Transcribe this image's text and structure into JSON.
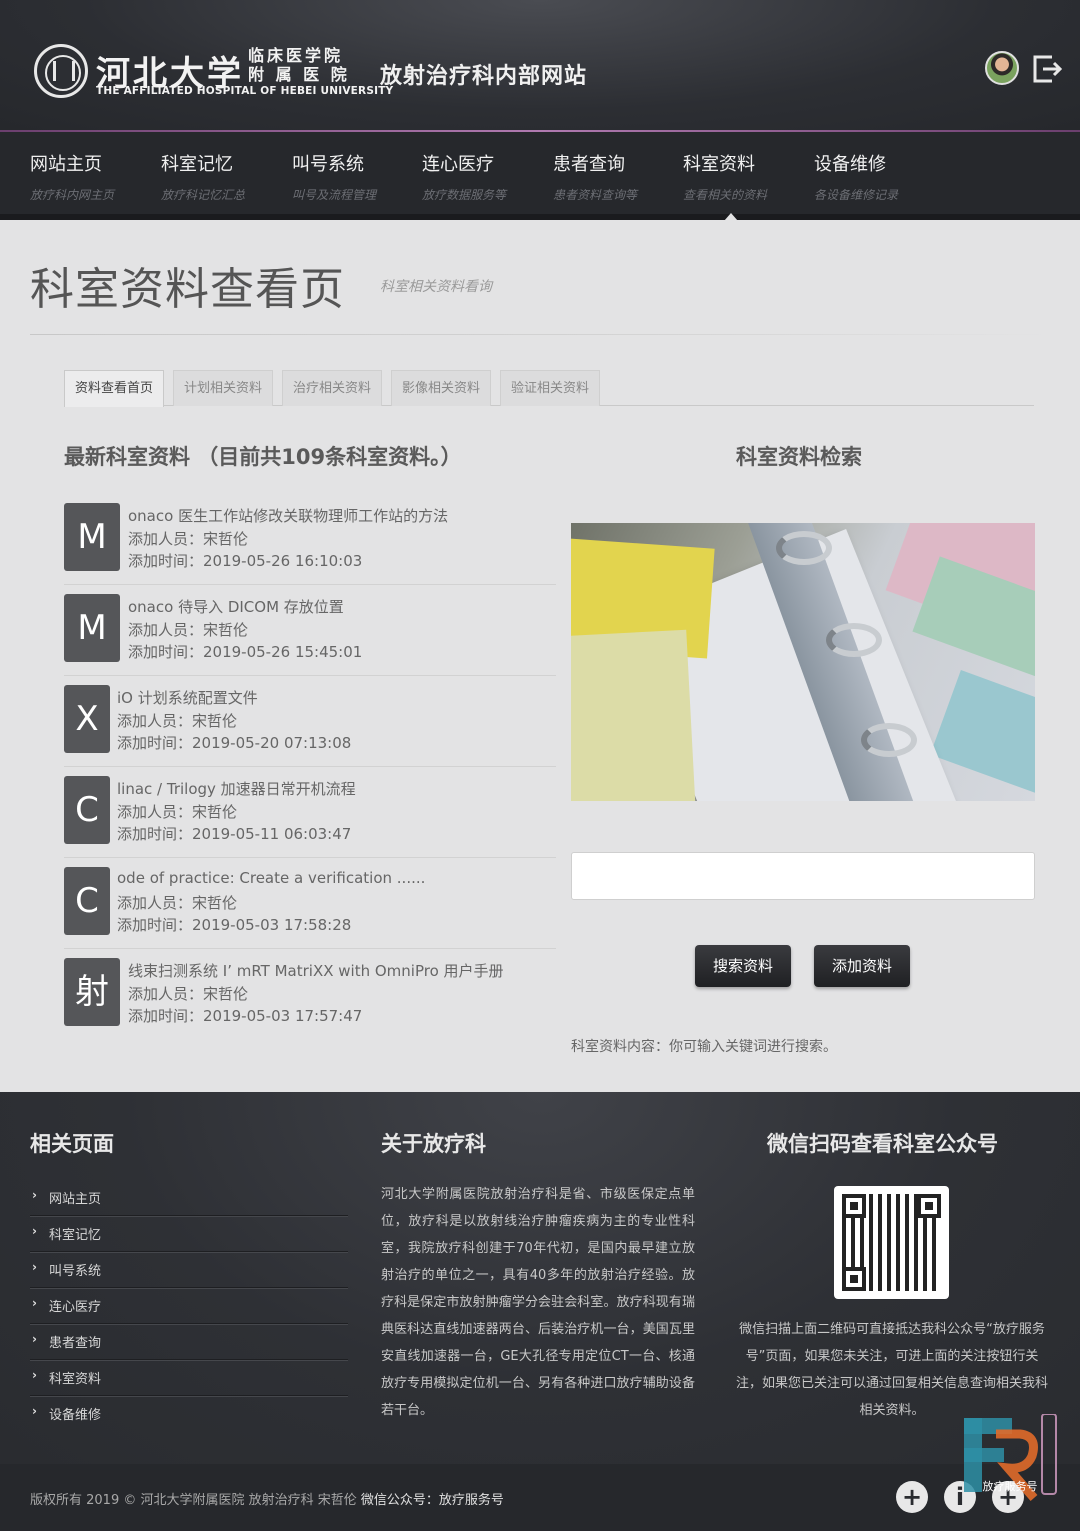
{
  "header": {
    "logo_cn": "河北大学",
    "logo_sub": "临床医学院附 属 医 院",
    "logo_en": "THE AFFILIATED HOSPITAL OF HEBEI UNIVERSITY",
    "site_title": "放射治疗科内部网站"
  },
  "nav": [
    {
      "label": "网站主页",
      "sub": "放疗科内网主页"
    },
    {
      "label": "科室记忆",
      "sub": "放疗科记忆汇总"
    },
    {
      "label": "叫号系统",
      "sub": "叫号及流程管理"
    },
    {
      "label": "连心医疗",
      "sub": "放疗数据服务等"
    },
    {
      "label": "患者查询",
      "sub": "患者资料查询等"
    },
    {
      "label": "科室资料",
      "sub": "查看相关的资料"
    },
    {
      "label": "设备维修",
      "sub": "各设备维修记录"
    }
  ],
  "page": {
    "title": "科室资料查看页",
    "subtitle": "科室相关资料看询"
  },
  "tabs": [
    "资料查看首页",
    "计划相关资料",
    "治疗相关资料",
    "影像相关资料",
    "验证相关资料"
  ],
  "list": {
    "title": "最新科室资料 （目前共109条科室资料。）",
    "items": [
      {
        "badge": "M",
        "title": "onaco 医生工作站修改关联物理师工作站的方法",
        "adder": "添加人员：宋哲伦",
        "time": "添加时间：2019-05-26 16:10:03"
      },
      {
        "badge": "M",
        "title": "onaco 待导入 DICOM 存放位置",
        "adder": "添加人员：宋哲伦",
        "time": "添加时间：2019-05-26 15:45:01"
      },
      {
        "badge": "X",
        "title": "iO 计划系统配置文件",
        "adder": "添加人员：宋哲伦",
        "time": "添加时间：2019-05-20 07:13:08"
      },
      {
        "badge": "C",
        "title": "linac / Trilogy 加速器日常开机流程",
        "adder": "添加人员：宋哲伦",
        "time": "添加时间：2019-05-11 06:03:47"
      },
      {
        "badge": "C",
        "title": "ode of practice: Create a verification ......",
        "adder": "添加人员：宋哲伦",
        "time": "添加时间：2019-05-03 17:58:28"
      },
      {
        "badge": "射",
        "title": "线束扫测系统 I’ mRT MatriXX with OmniPro 用户手册",
        "adder": "添加人员：宋哲伦",
        "time": "添加时间：2019-05-03 17:57:47"
      }
    ]
  },
  "search": {
    "title": "科室资料检索",
    "placeholder": "",
    "search_button": "搜索资料",
    "add_button": "添加资料",
    "hint": "科室资料内容：你可输入关键词进行搜索。"
  },
  "footer": {
    "links_title": "相关页面",
    "links": [
      "网站主页",
      "科室记忆",
      "叫号系统",
      "连心医疗",
      "患者查询",
      "科室资料",
      "设备维修"
    ],
    "about_title": "关于放疗科",
    "about_text": "河北大学附属医院放射治疗科是省、市级医保定点单位，放疗科是以放射线治疗肿瘤疾病为主的专业性科室，我院放疗科创建于70年代初，是国内最早建立放射治疗的单位之一，具有40多年的放射治疗经验。放疗科是保定市放射肿瘤学分会驻会科室。放疗科现有瑞典医科达直线加速器两台、后装治疗机一台，美国瓦里安直线加速器一台，GE大孔径专用定位CT一台、核通放疗专用模拟定位机一台、另有各种进口放疗辅助设备若干台。",
    "wechat_title": "微信扫码查看科室公众号",
    "wechat_text": "微信扫描上面二维码可直接抵达我科公众号“放疗服务号”页面，如果您未关注，可进上面的关注按钮行关注，如果您已关注可以通过回复相关信息查询相关我科相关资料。",
    "copyright": "版权所有 2019 © 河北大学附属医院 放射治疗科 宋哲伦",
    "wechat_account": "微信公众号：放疗服务号",
    "watermark_text": "放疗服务号"
  }
}
